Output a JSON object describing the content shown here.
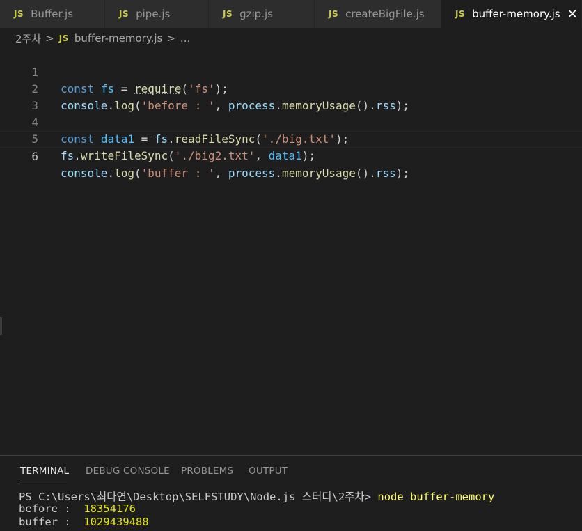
{
  "tabs": [
    {
      "icon": "JS",
      "label": "Buffer.js"
    },
    {
      "icon": "JS",
      "label": "pipe.js"
    },
    {
      "icon": "JS",
      "label": "gzip.js"
    },
    {
      "icon": "JS",
      "label": "createBigFile.js"
    },
    {
      "icon": "JS",
      "label": "buffer-memory.js",
      "active": true
    }
  ],
  "tab_close_glyph": "✕",
  "breadcrumb": {
    "folder": "2주차",
    "sep": ">",
    "file_icon": "JS",
    "file": "buffer-memory.js",
    "tail": "..."
  },
  "editor": {
    "line_numbers": [
      "1",
      "2",
      "3",
      "4",
      "5",
      "6"
    ],
    "current_line": 6,
    "lines": [
      [
        [
          "kw",
          "const"
        ],
        [
          "op",
          " "
        ],
        [
          "var",
          "fs"
        ],
        [
          "op",
          " = "
        ],
        [
          "req",
          "require"
        ],
        [
          "op",
          "("
        ],
        [
          "str",
          "'fs'"
        ],
        [
          "op",
          ");"
        ]
      ],
      [
        [
          "id",
          "console"
        ],
        [
          "op",
          "."
        ],
        [
          "fn",
          "log"
        ],
        [
          "op",
          "("
        ],
        [
          "str",
          "'before : '"
        ],
        [
          "op",
          ", "
        ],
        [
          "id",
          "process"
        ],
        [
          "op",
          "."
        ],
        [
          "fn",
          "memoryUsage"
        ],
        [
          "op",
          "()."
        ],
        [
          "id",
          "rss"
        ],
        [
          "op",
          ");"
        ]
      ],
      [],
      [
        [
          "kw",
          "const"
        ],
        [
          "op",
          " "
        ],
        [
          "var",
          "data1"
        ],
        [
          "op",
          " = "
        ],
        [
          "id",
          "fs"
        ],
        [
          "op",
          "."
        ],
        [
          "fn",
          "readFileSync"
        ],
        [
          "op",
          "("
        ],
        [
          "str",
          "'./big.txt'"
        ],
        [
          "op",
          ");"
        ]
      ],
      [
        [
          "id",
          "fs"
        ],
        [
          "op",
          "."
        ],
        [
          "fn",
          "writeFileSync"
        ],
        [
          "op",
          "("
        ],
        [
          "str",
          "'./big2.txt'"
        ],
        [
          "op",
          ", "
        ],
        [
          "var",
          "data1"
        ],
        [
          "op",
          ");"
        ]
      ],
      [
        [
          "id",
          "console"
        ],
        [
          "op",
          "."
        ],
        [
          "fn",
          "log"
        ],
        [
          "op",
          "("
        ],
        [
          "str",
          "'buffer : '"
        ],
        [
          "op",
          ", "
        ],
        [
          "id",
          "process"
        ],
        [
          "op",
          "."
        ],
        [
          "fn",
          "memoryUsage"
        ],
        [
          "op",
          "()."
        ],
        [
          "id",
          "rss"
        ],
        [
          "op",
          ");"
        ]
      ]
    ]
  },
  "panel": {
    "tabs": [
      "TERMINAL",
      "DEBUG CONSOLE",
      "PROBLEMS",
      "OUTPUT"
    ],
    "active_tab": "TERMINAL",
    "terminal": {
      "prompt": "PS C:\\Users\\최다연\\Desktop\\SELFSTUDY\\Node.js 스터디\\2주차> ",
      "command": "node buffer-memory",
      "outputs": [
        {
          "label": "before :  ",
          "value": "18354176"
        },
        {
          "label": "buffer :  ",
          "value": "1029439488"
        }
      ]
    }
  },
  "colors": {
    "background": "#1e1e1e",
    "tab_bar": "#252526",
    "inactive_tab": "#2d2d2d",
    "js_icon": "#cbcb41",
    "keyword": "#569cd6",
    "string": "#ce9178",
    "function": "#dcdcaa",
    "identifier": "#9cdcfe"
  }
}
